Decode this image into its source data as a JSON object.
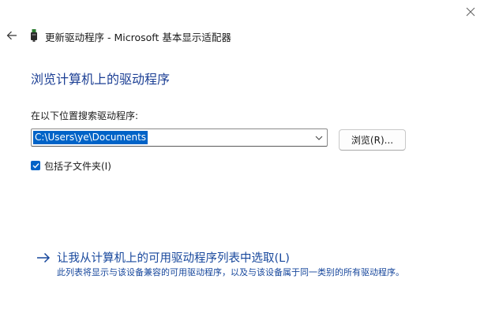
{
  "window": {
    "title": "更新驱动程序 - Microsoft 基本显示适配器"
  },
  "page": {
    "heading": "浏览计算机上的驱动程序",
    "search_label": "在以下位置搜索驱动程序:",
    "path_value": "C:\\Users\\ye\\Documents",
    "browse_label": "浏览(R)...",
    "include_subfolders_label": "包括子文件夹(I)",
    "include_subfolders_checked": true
  },
  "link": {
    "label": "让我从计算机上的可用驱动程序列表中选取(L)",
    "description": "此列表将显示与该设备兼容的可用驱动程序，以及与该设备属于同一类别的所有驱动程序。"
  },
  "colors": {
    "accent": "#0063c7",
    "link": "#17479c",
    "heading": "#1c3f94"
  },
  "icons": {
    "back": "back-arrow-icon",
    "device": "display-adapter-icon",
    "close": "close-icon",
    "dropdown": "chevron-down-icon",
    "check": "checkmark-icon",
    "link": "arrow-right-icon"
  }
}
